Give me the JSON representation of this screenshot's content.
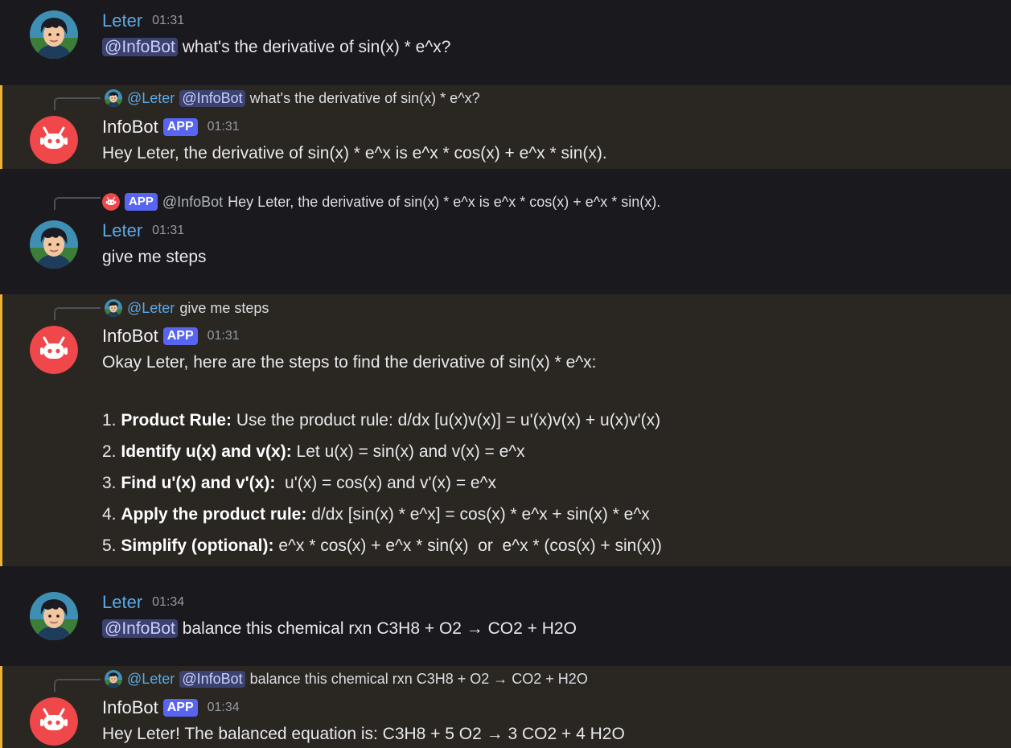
{
  "messages": {
    "m1": {
      "author": "Leter",
      "time": "01:31",
      "mention": "@InfoBot",
      "text": " what's the derivative of sin(x) * e^x?"
    },
    "m2": {
      "reply_name": "@Leter",
      "reply_mention": "@InfoBot",
      "reply_text": "what's the derivative of sin(x) * e^x?",
      "author": "InfoBot",
      "badge": "APP",
      "time": "01:31",
      "text": "Hey Leter, the derivative of sin(x) * e^x is e^x * cos(x) + e^x * sin(x)."
    },
    "m3": {
      "reply_badge": "APP",
      "reply_name": "@InfoBot",
      "reply_text": "Hey Leter, the derivative of sin(x) * e^x is e^x * cos(x) + e^x * sin(x).",
      "author": "Leter",
      "time": "01:31",
      "text": "give me steps"
    },
    "m4": {
      "reply_name": "@Leter",
      "reply_text": "give me steps",
      "author": "InfoBot",
      "badge": "APP",
      "time": "01:31",
      "intro": "Okay Leter, here are the steps to find the derivative of sin(x) * e^x:",
      "steps": [
        {
          "num": "1. ",
          "label": "Product Rule:",
          "text": " Use the product rule: d/dx [u(x)v(x)] = u'(x)v(x) + u(x)v'(x)"
        },
        {
          "num": "2. ",
          "label": "Identify u(x) and v(x):",
          "text": " Let u(x) = sin(x) and v(x) = e^x"
        },
        {
          "num": "3. ",
          "label": "Find u'(x) and v'(x):",
          "text": "  u'(x) = cos(x) and v'(x) = e^x"
        },
        {
          "num": "4. ",
          "label": "Apply the product rule:",
          "text": " d/dx [sin(x) * e^x] = cos(x) * e^x + sin(x) * e^x"
        },
        {
          "num": "5. ",
          "label": "Simplify (optional):",
          "text": " e^x * cos(x) + e^x * sin(x)  or  e^x * (cos(x) + sin(x))"
        }
      ]
    },
    "m5": {
      "author": "Leter",
      "time": "01:34",
      "mention": "@InfoBot",
      "text": " balance this chemical rxn C3H8 + O2 → CO2 + H2O"
    },
    "m6": {
      "reply_name": "@Leter",
      "reply_mention": "@InfoBot",
      "reply_text": "balance this chemical rxn C3H8 + O2 → CO2 + H2O",
      "author": "InfoBot",
      "badge": "APP",
      "time": "01:34",
      "text": "Hey Leter! The balanced equation is: C3H8 + 5 O2 → 3 CO2 + 4 H2O"
    }
  },
  "colors": {
    "background": "#1a1a1e",
    "mention_highlight": "#2a2622",
    "mention_border": "#f0b232",
    "username": "#5aa9e6",
    "app_badge": "#5865f2",
    "bot_avatar": "#f0474b"
  }
}
